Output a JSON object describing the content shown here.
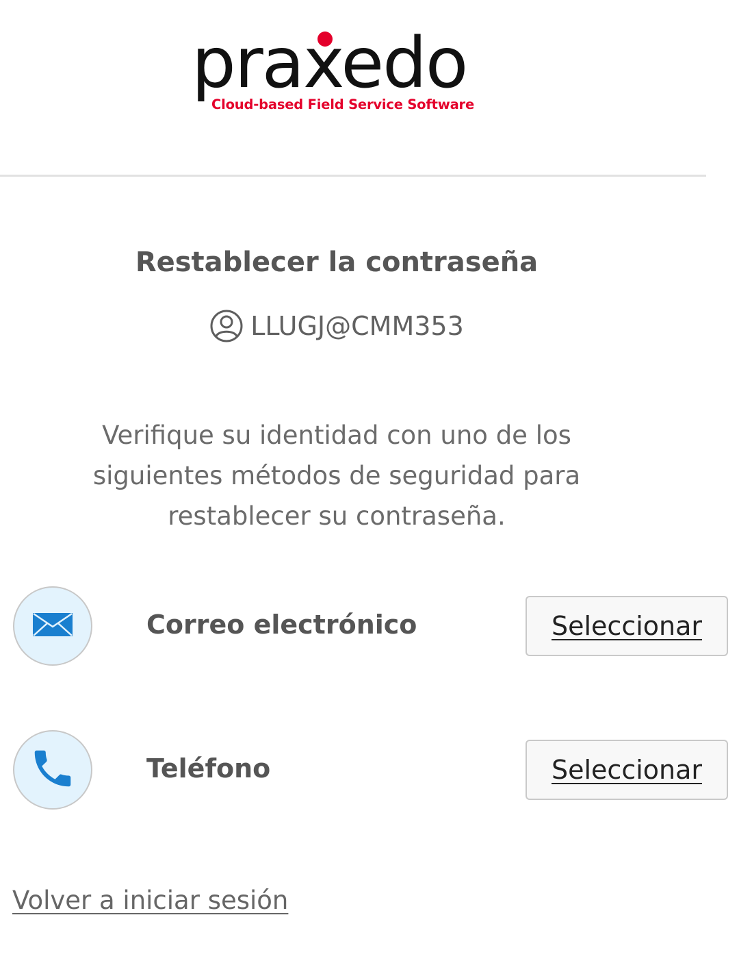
{
  "logo": {
    "wordmark": "praxedo",
    "tagline": "Cloud-based Field Service Software",
    "brand_color": "#e4002b"
  },
  "page": {
    "title": "Restablecer la contraseña",
    "user_icon": "user-circle-icon",
    "user_id": "LLUGJ@CMM353",
    "instructions": "Verifique su identidad con uno de los siguientes métodos de seguridad para restablecer su contraseña."
  },
  "methods": [
    {
      "icon": "envelope-icon",
      "label": "Correo electrónico",
      "button_label": "Seleccionar",
      "accent_color": "#1a7fcf"
    },
    {
      "icon": "phone-icon",
      "label": "Teléfono",
      "button_label": "Seleccionar",
      "accent_color": "#1a7fcf"
    }
  ],
  "footer": {
    "back_link": "Volver a iniciar sesión"
  }
}
